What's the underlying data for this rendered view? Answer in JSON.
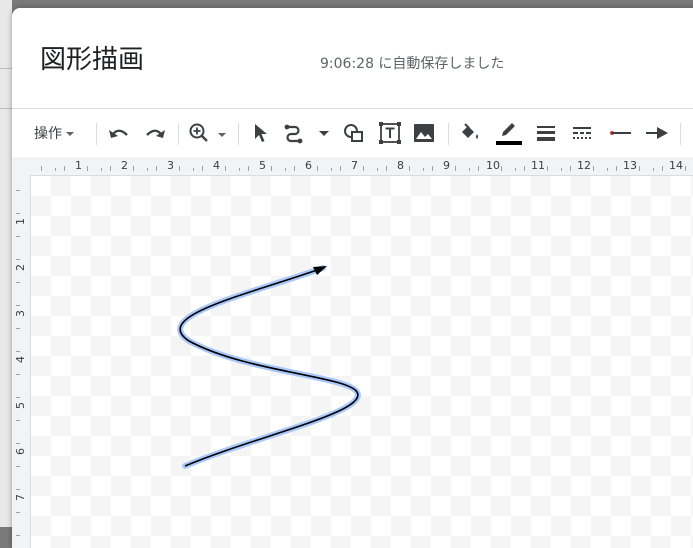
{
  "dialog": {
    "title": "図形描画",
    "autosave": "9:06:28 に自動保存しました"
  },
  "toolbar": {
    "actions_label": "操作",
    "buttons": [
      {
        "name": "undo-icon"
      },
      {
        "name": "redo-icon"
      },
      {
        "name": "zoom-icon"
      },
      {
        "name": "select-icon"
      },
      {
        "name": "line-icon"
      },
      {
        "name": "shape-icon"
      },
      {
        "name": "textbox-icon"
      },
      {
        "name": "image-icon"
      },
      {
        "name": "fill-color-icon"
      },
      {
        "name": "line-color-icon"
      },
      {
        "name": "line-weight-icon"
      },
      {
        "name": "line-dash-icon"
      },
      {
        "name": "line-start-icon"
      },
      {
        "name": "line-end-icon"
      }
    ],
    "line_color": "#000000",
    "line_start_color": "#d93025"
  },
  "ruler": {
    "top": [
      "1",
      "2",
      "3",
      "4",
      "5",
      "6",
      "7",
      "8",
      "9",
      "10",
      "11",
      "12",
      "13",
      "14"
    ],
    "left": [
      "1",
      "2",
      "3",
      "4",
      "5",
      "6",
      "7"
    ]
  },
  "canvas": {
    "shape": "curved-arrow",
    "stroke": "#000000",
    "selection_halo": "#a8c7fa"
  }
}
